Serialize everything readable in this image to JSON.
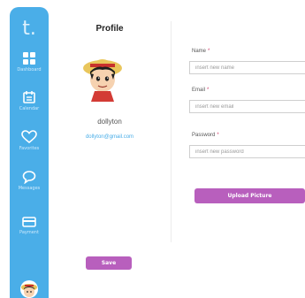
{
  "sidebar": {
    "logo": "t.",
    "items": [
      {
        "label": "Dashboard",
        "icon": "grid-icon"
      },
      {
        "label": "Calendar",
        "icon": "calendar-icon"
      },
      {
        "label": "Favorites",
        "icon": "heart-icon"
      },
      {
        "label": "Messages",
        "icon": "chat-icon"
      },
      {
        "label": "Payment",
        "icon": "card-icon"
      }
    ]
  },
  "profile": {
    "title": "Profile",
    "name": "dollyton",
    "email": "dollyton@gmail.com"
  },
  "form": {
    "name_label": "Name",
    "name_placeholder": "insert new name",
    "email_label": "Email",
    "email_placeholder": "insert new email",
    "password_label": "Password",
    "password_placeholder": "insert new password",
    "required_mark": "*",
    "upload_label": "Upload Picture",
    "save_label": "Save"
  },
  "colors": {
    "sidebar": "#4aaee8",
    "accent_button": "#b85fbd",
    "email_link": "#4aaee8"
  }
}
